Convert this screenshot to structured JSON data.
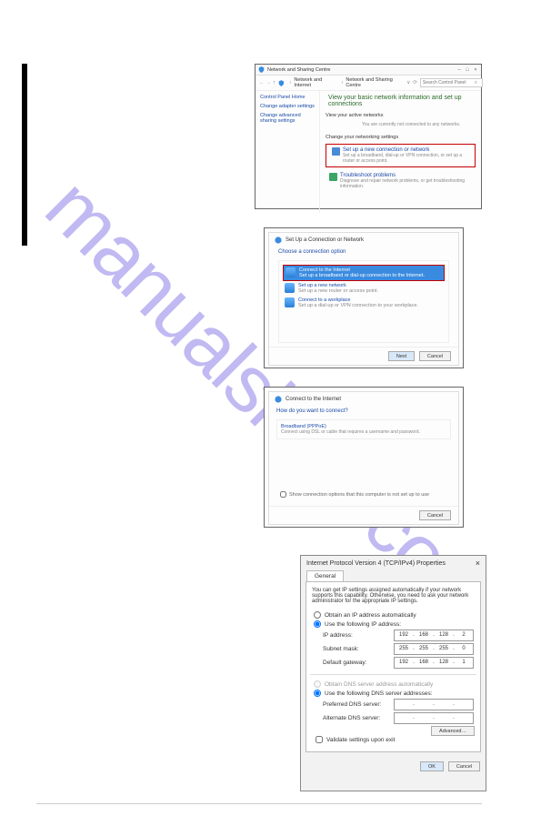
{
  "watermark": "manualshive.com",
  "s1": {
    "win_title": "Network and Sharing Centre",
    "bc_arrow_up": "↑",
    "bc_seg1": "Network and Internet",
    "bc_seg2": "Network and Sharing Centre",
    "search_placeholder": "Search Control Panel",
    "side_home": "Control Panel Home",
    "side_adapter": "Change adapter settings",
    "side_adv": "Change advanced sharing settings",
    "main_title": "View your basic network information and set up connections",
    "view_active": "View your active networks",
    "not_conn": "You are currently not connected to any networks.",
    "change_net": "Change your networking settings",
    "setup_link": "Set up a new connection or network",
    "setup_desc": "Set up a broadband, dial-up or VPN connection, or set up a router or access point.",
    "trouble_link": "Troubleshoot problems",
    "trouble_desc": "Diagnose and repair network problems, or get troubleshooting information."
  },
  "s2": {
    "win_title": "Set Up a Connection or Network",
    "choose": "Choose a connection option",
    "o1_t": "Connect to the Internet",
    "o1_d": "Set up a broadband or dial-up connection to the Internet.",
    "o2_t": "Set up a new network",
    "o2_d": "Set up a new router or access point.",
    "o3_t": "Connect to a workplace",
    "o3_d": "Set up a dial-up or VPN connection to your workplace.",
    "next": "Next",
    "cancel": "Cancel"
  },
  "s3": {
    "win_title": "Connect to the Internet",
    "how": "How do you want to connect?",
    "bb_t": "Broadband (PPPoE)",
    "bb_d": "Connect using DSL or cable that requires a username and password.",
    "show": "Show connection options that this computer is not set up to use",
    "cancel": "Cancel"
  },
  "s4": {
    "title": "Internet Protocol Version 4 (TCP/IPv4) Properties",
    "tab": "General",
    "desc": "You can get IP settings assigned automatically if your network supports this capability. Otherwise, you need to ask your network administrator for the appropriate IP settings.",
    "obtain_ip": "Obtain an IP address automatically",
    "use_ip": "Use the following IP address:",
    "lbl_ip": "IP address:",
    "lbl_mask": "Subnet mask:",
    "lbl_gw": "Default gateway:",
    "ip": [
      "192",
      "168",
      "128",
      "2"
    ],
    "mask": [
      "255",
      "255",
      "255",
      "0"
    ],
    "gw": [
      "192",
      "168",
      "128",
      "1"
    ],
    "obtain_dns": "Obtain DNS server address automatically",
    "use_dns": "Use the following DNS server addresses:",
    "lbl_pref": "Preferred DNS server:",
    "lbl_alt": "Alternate DNS server:",
    "validate": "Validate settings upon exit",
    "advanced": "Advanced…",
    "ok": "OK",
    "cancel": "Cancel",
    "x": "×"
  }
}
